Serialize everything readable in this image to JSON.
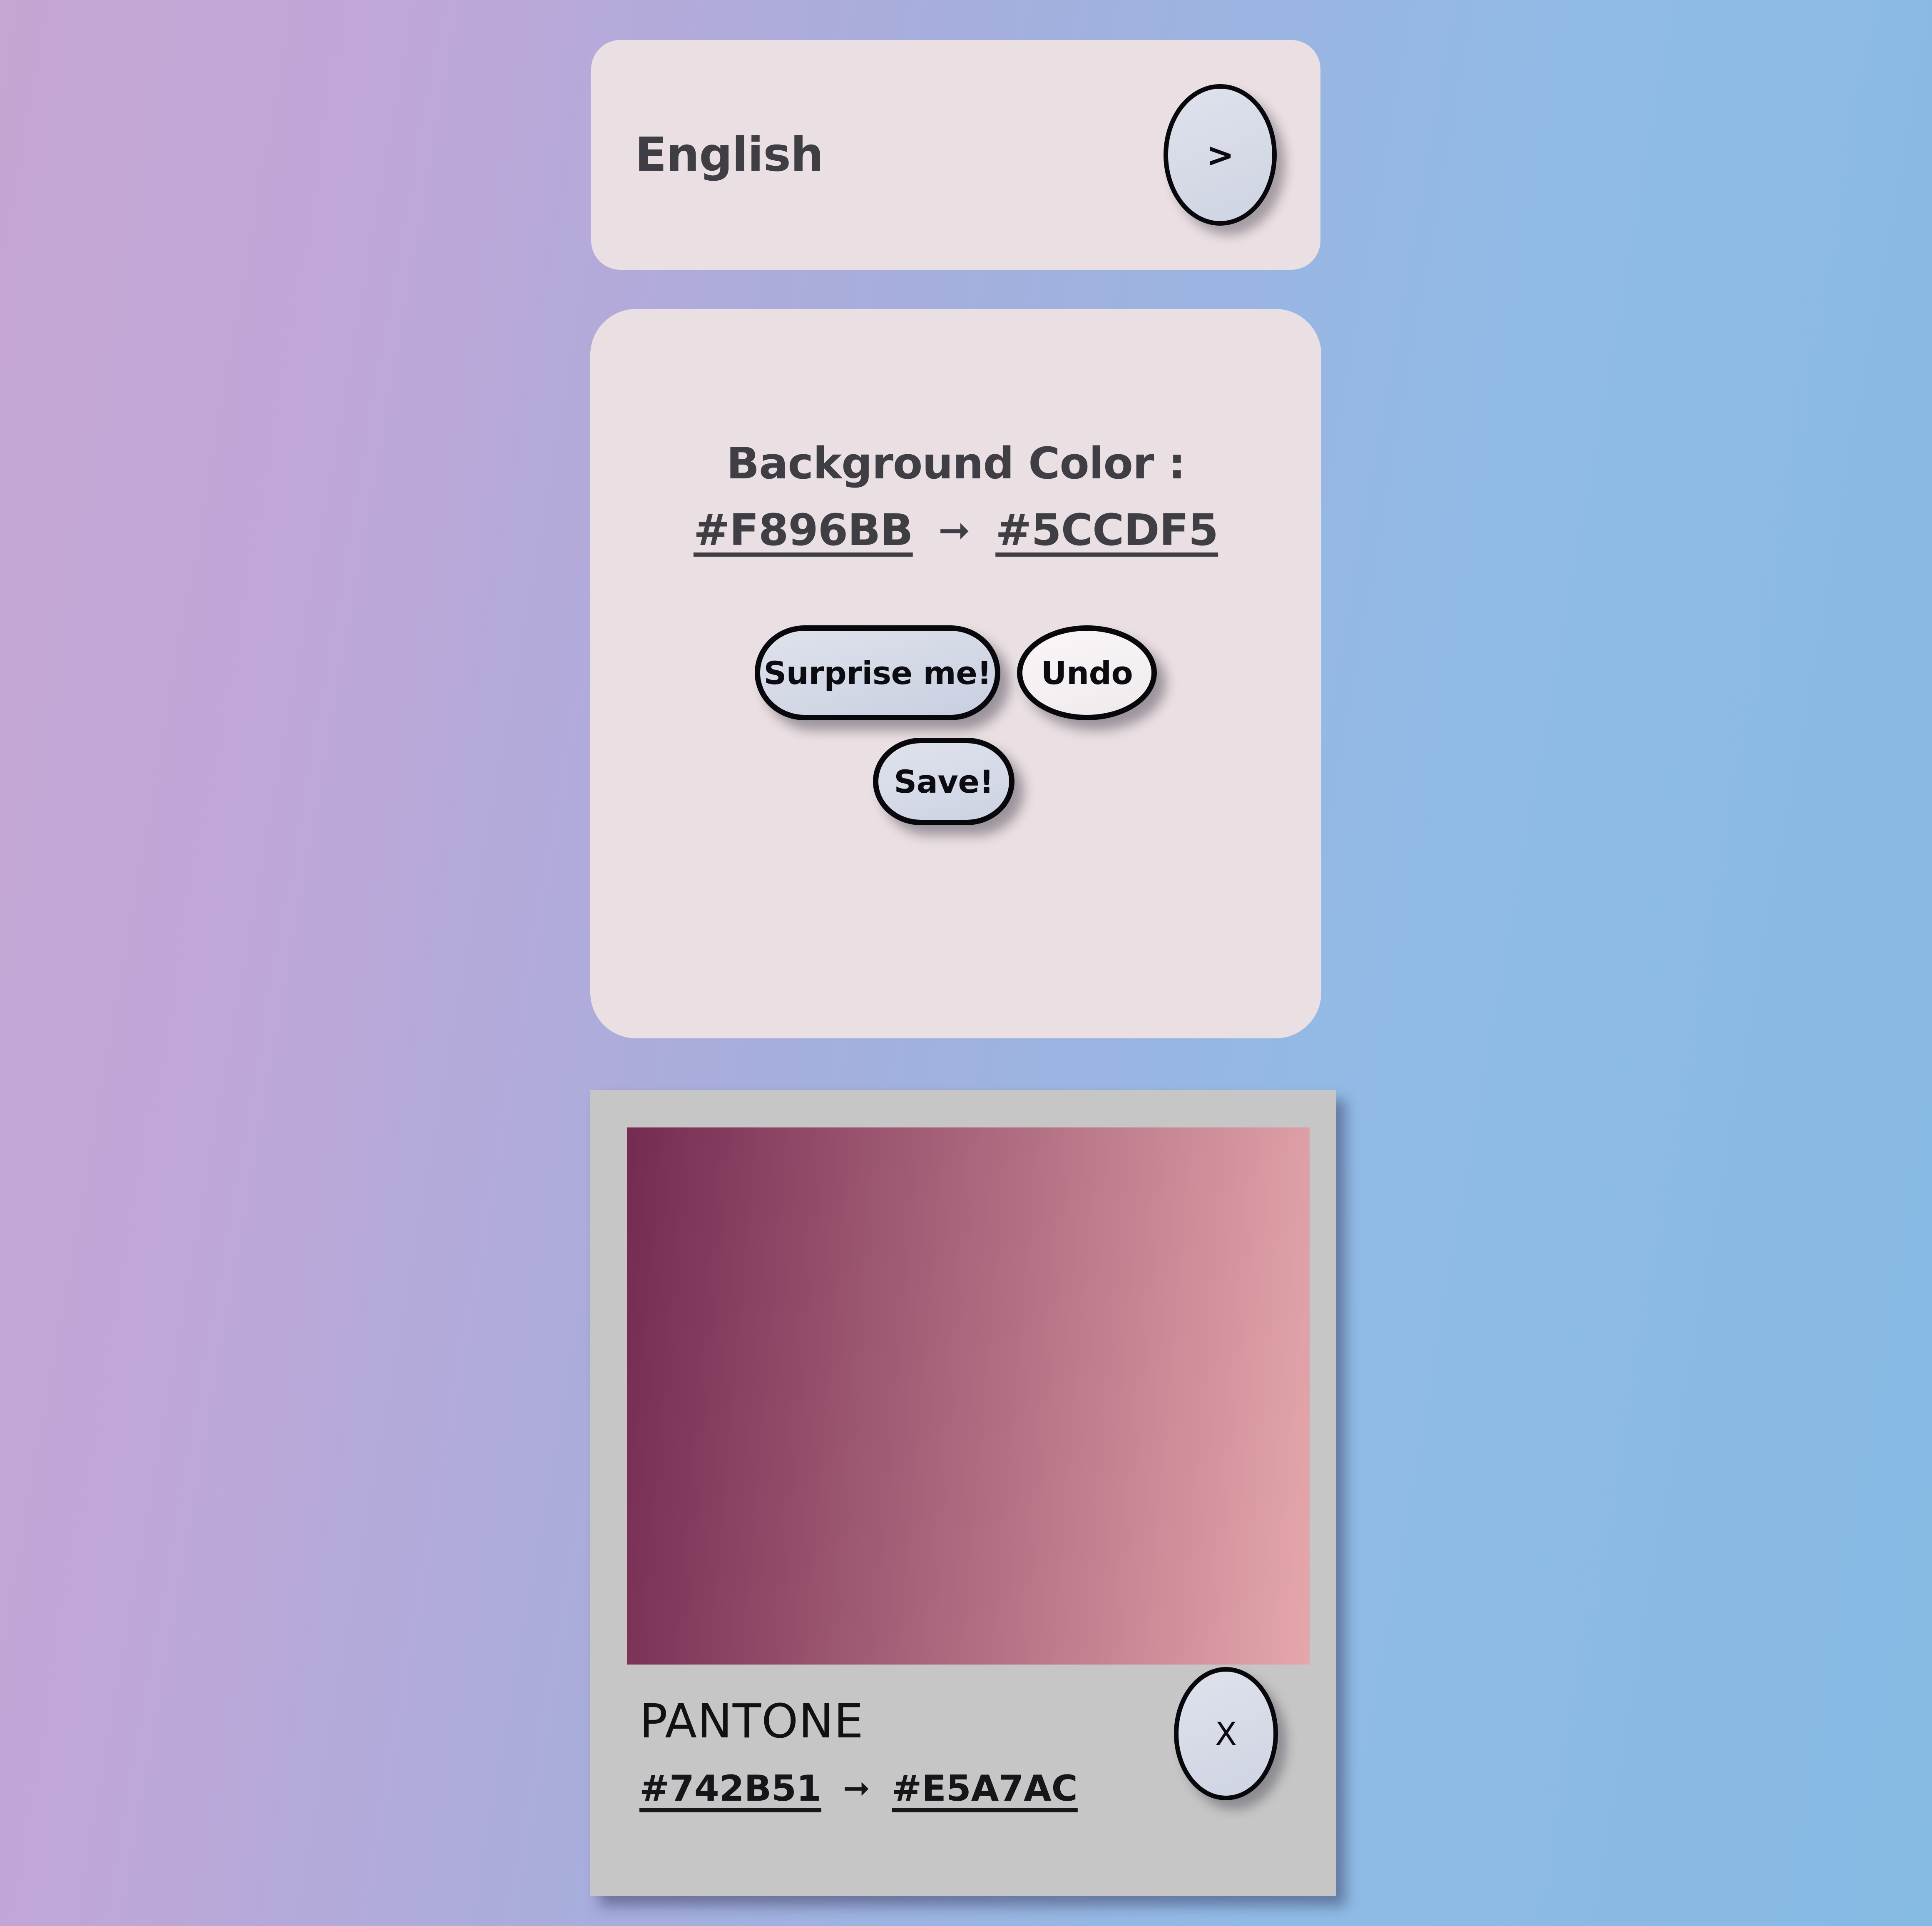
{
  "background": {
    "gradient_from": "#C5A5D2",
    "gradient_to": "#85BAE3"
  },
  "language_card": {
    "label": "English",
    "next_button": ">"
  },
  "background_color_card": {
    "title": "Background Color :",
    "from_hex": "#F896BB",
    "arrow": "➞",
    "to_hex": "#5CCDF5",
    "surprise_label": "Surprise me!",
    "undo_label": "Undo",
    "save_label": "Save!"
  },
  "pantone_card": {
    "brand": "PANTONE",
    "from_hex": "#742B51",
    "arrow": "➞",
    "to_hex": "#E5A7AC",
    "close_label": "X",
    "swatch": {
      "gradient_from": "#742B51",
      "gradient_to": "#E5A7AC"
    },
    "card_color": "#C6C6C6"
  }
}
